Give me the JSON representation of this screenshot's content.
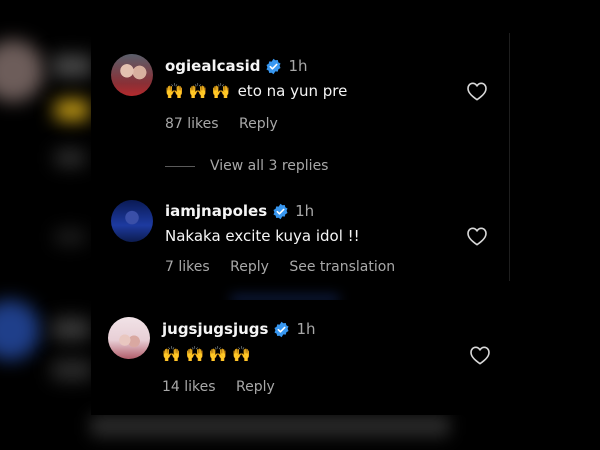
{
  "comments": [
    {
      "username": "ogiealcasid",
      "time": "1h",
      "emoji": "🙌 🙌 🙌",
      "text": "eto na yun pre",
      "likes": "87 likes",
      "reply": "Reply"
    },
    {
      "username": "iamjnapoles",
      "time": "1h",
      "text": "Nakaka excite kuya idol !!",
      "likes": "7 likes",
      "reply": "Reply",
      "translate": "See translation"
    },
    {
      "username": "jugsjugsjugs",
      "time": "1h",
      "emoji": "🙌 🙌 🙌 🙌",
      "likes": "14 likes",
      "reply": "Reply"
    }
  ],
  "view_replies": "View all 3 replies",
  "icons": {
    "verified": "verified-badge-icon",
    "heart": "heart-outline-icon",
    "emoji": "raising-hands-emoji"
  },
  "colors": {
    "background": "#000000",
    "text": "#f5f5f5",
    "muted": "#a8a8a8",
    "verified": "#3897f0"
  }
}
